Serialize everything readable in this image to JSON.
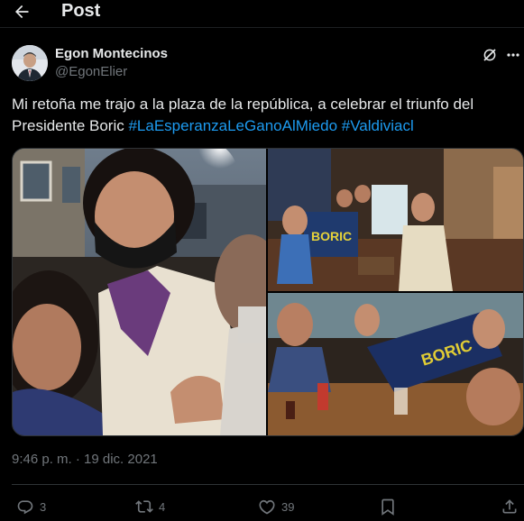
{
  "header": {
    "title": "Post",
    "back_icon": "arrow-left-icon"
  },
  "author": {
    "name": "Egon Montecinos",
    "handle": "@EgonElier",
    "avatar": "profile-photo"
  },
  "tweet": {
    "text": "Mi retoña me trajo a la plaza de la república, a celebrar el triunfo del Presidente Boric",
    "hashtags": [
      "#LaEsperanzaLeGanoAlMiedo",
      "#Valdiviacl"
    ]
  },
  "media": {
    "photos": [
      {
        "name": "photo-selfie-group",
        "subject": "selfie of three people at night in a plaza"
      },
      {
        "name": "photo-bar-boric-flag",
        "subject": "group holding Boric flag inside a bar"
      },
      {
        "name": "photo-bar-table-celebration",
        "subject": "people at tables with Boric banner"
      }
    ]
  },
  "timestamp": "9:46 p. m. · 19 dic. 2021",
  "actions": {
    "replies": "3",
    "reposts": "4",
    "likes": "39"
  },
  "colors": {
    "accent": "#1d9bf0",
    "text": "#e7e9ea",
    "muted": "#71767b",
    "background": "#000000"
  }
}
